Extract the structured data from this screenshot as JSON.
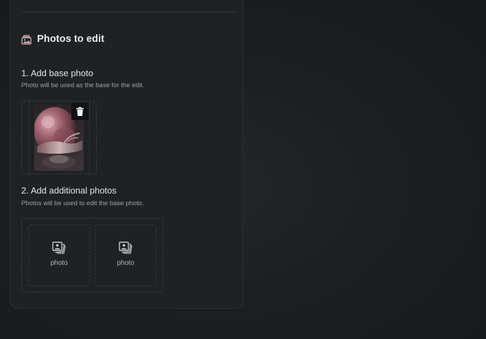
{
  "section": {
    "title": "Photos to edit",
    "icon": "photo-stack-icon"
  },
  "base": {
    "title": "1. Add base photo",
    "subtitle": "Photo will be used as the base for the edit.",
    "delete_icon": "trash-icon"
  },
  "additional": {
    "title": "2. Add additional photos",
    "subtitle": "Photos will be used to edit the base photo.",
    "slots": [
      {
        "label": "photo",
        "icon": "photo-stack-icon"
      },
      {
        "label": "photo",
        "icon": "photo-stack-icon"
      }
    ]
  },
  "colors": {
    "panel": "#1f2224",
    "background": "#1a1d1f",
    "accent_text": "#eceeef",
    "muted_text": "#9ea3a6"
  }
}
